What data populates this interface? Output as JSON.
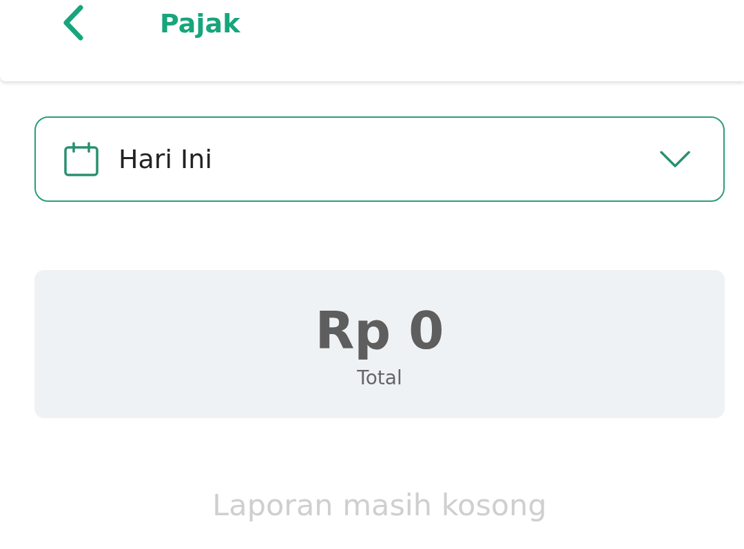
{
  "header": {
    "title": "Pajak"
  },
  "date_filter": {
    "value": "Hari Ini",
    "expanded": false
  },
  "summary": {
    "amount": "Rp 0",
    "label": "Total"
  },
  "empty_state": {
    "message": "Laporan masih kosong"
  }
}
